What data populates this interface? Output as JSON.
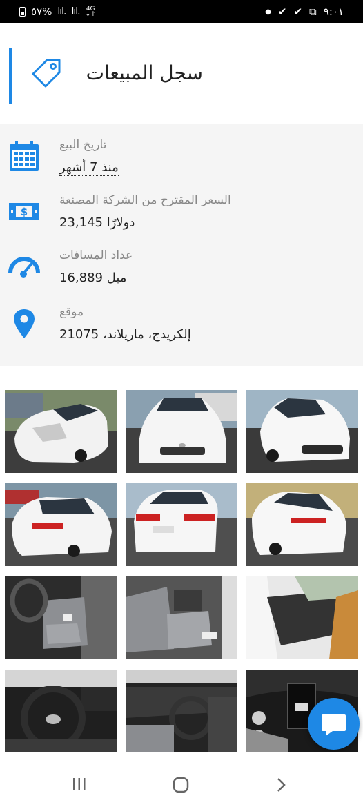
{
  "status_bar": {
    "battery_percent": "٥٧%",
    "network": "4G",
    "time": "٩:٠١"
  },
  "header": {
    "title": "سجل المبيعات",
    "icon": "tag-icon"
  },
  "sale_info": {
    "rows": [
      {
        "icon": "calendar-icon",
        "label": "تاريخ البيع",
        "value": "منذ 7 أشهر"
      },
      {
        "icon": "price-tag-dollar-icon",
        "label": "السعر المقترح من الشركة المصنعة",
        "value": "دولارًا 23,145"
      },
      {
        "icon": "speedometer-icon",
        "label": "عداد المسافات",
        "value": "ميل 16,889"
      },
      {
        "icon": "location-pin-icon",
        "label": "موقع",
        "value": "إلكريدج، ماريلاند، 21075"
      }
    ]
  },
  "gallery": {
    "photos": [
      "front-left-damaged",
      "front",
      "front-right",
      "rear-left",
      "rear",
      "rear-right",
      "interior-driver-seat",
      "interior-seats",
      "door-panel",
      "dashboard-steering",
      "dashboard-console",
      "instrument-cluster"
    ]
  },
  "chat_button": {
    "icon": "chat-bubble-icon"
  },
  "nav_bar": {
    "recent_icon": "recent-apps-icon",
    "home_icon": "home-icon",
    "back_icon": "back-icon"
  },
  "colors": {
    "accent": "#1e88e5",
    "info_bg": "#f5f5f5"
  }
}
